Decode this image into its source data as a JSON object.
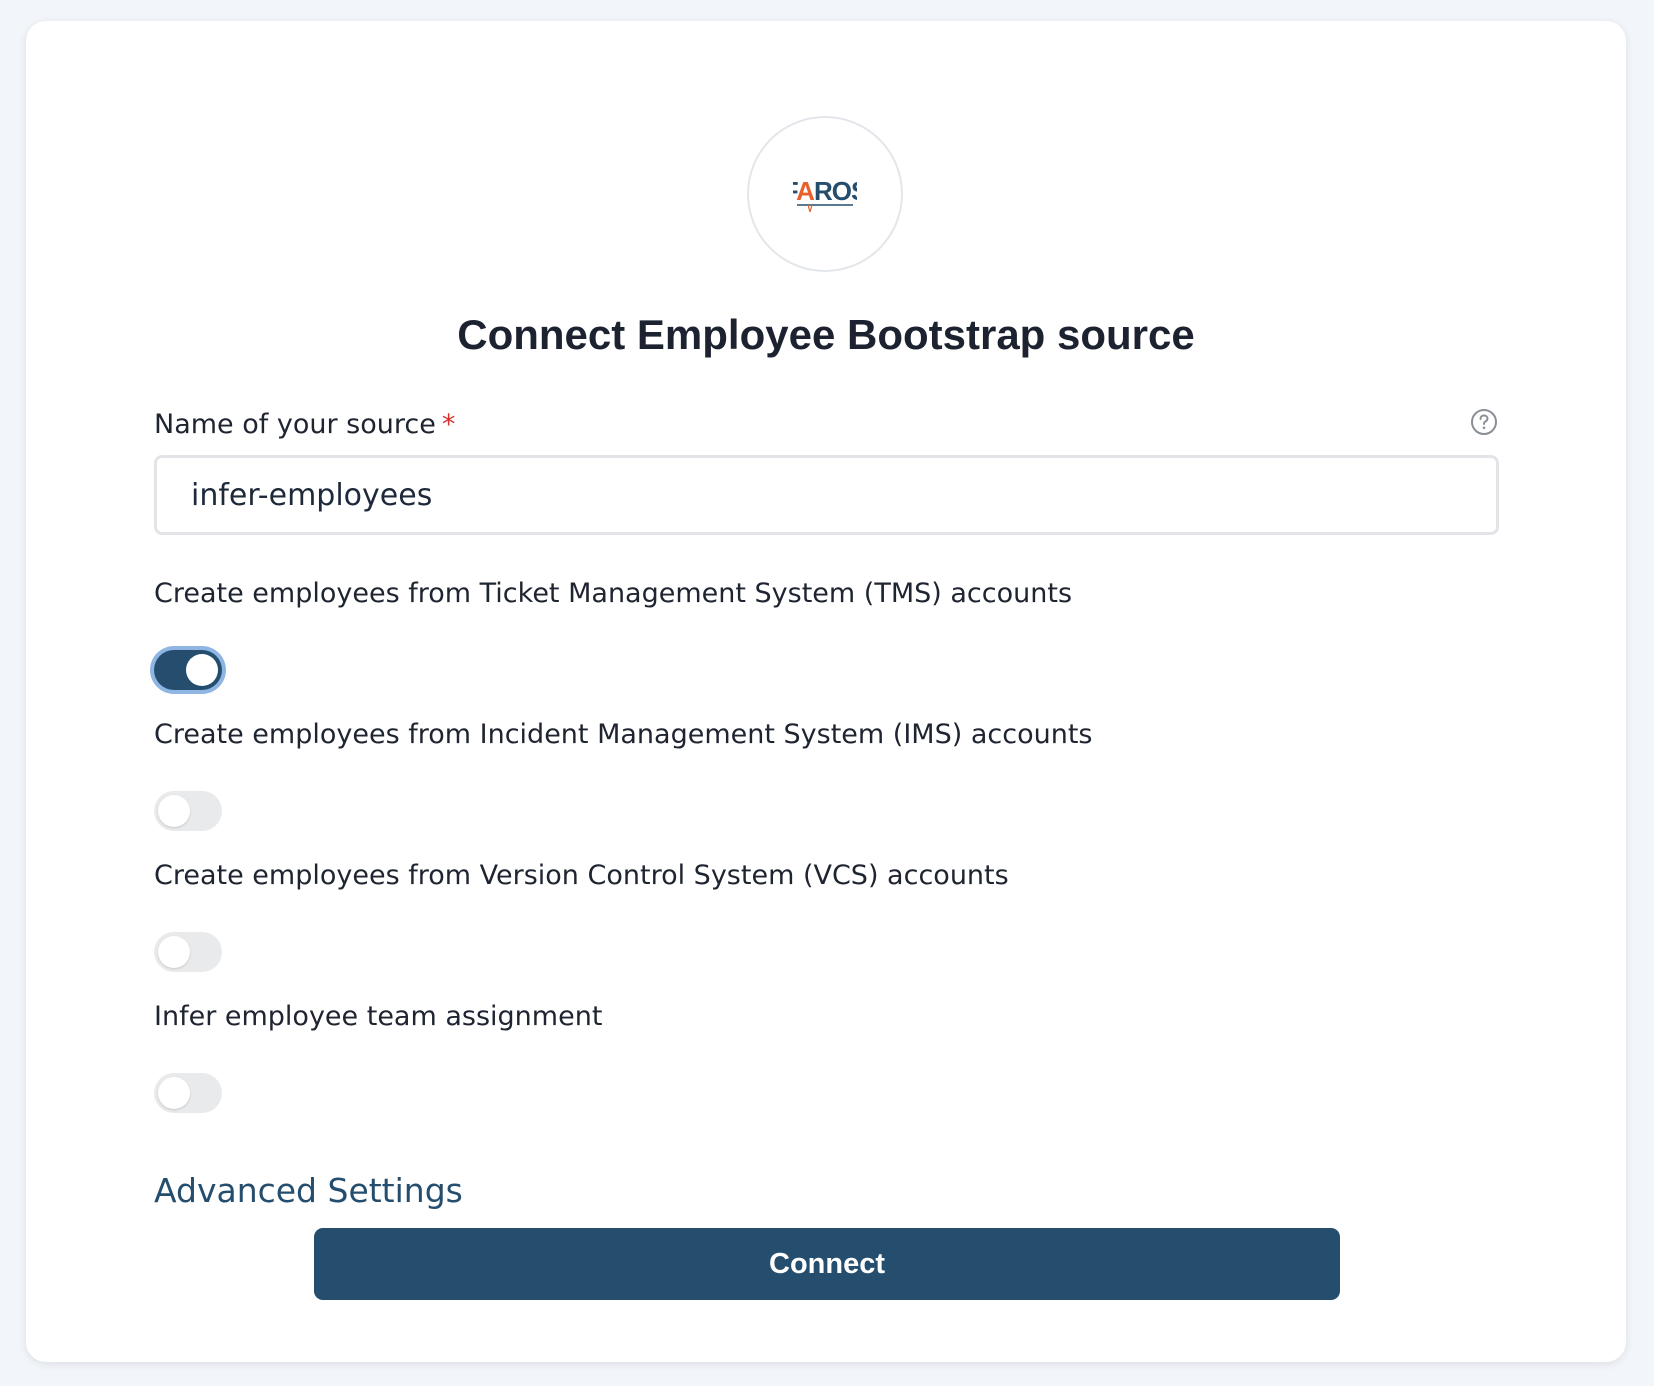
{
  "logo": {
    "text": "FAROS",
    "icon": "faros-logo",
    "colors": {
      "primary": "#254e6e",
      "accent": "#e8602c"
    }
  },
  "title": "Connect Employee Bootstrap source",
  "name_field": {
    "label": "Name of your source",
    "required_marker": "*",
    "value": "infer-employees",
    "help_icon": "question-circle-icon"
  },
  "toggles": [
    {
      "label": "Create employees from Ticket Management System (TMS) accounts",
      "enabled": true
    },
    {
      "label": "Create employees from Incident Management System (IMS) accounts",
      "enabled": false
    },
    {
      "label": "Create employees from Version Control System (VCS) accounts",
      "enabled": false
    },
    {
      "label": "Infer employee team assignment",
      "enabled": false
    }
  ],
  "advanced_settings_label": "Advanced Settings",
  "connect_label": "Connect",
  "colors": {
    "brand": "#254e6e",
    "focus_ring": "#8fb6e3",
    "required": "#d6342c",
    "background": "#f2f5f9"
  }
}
